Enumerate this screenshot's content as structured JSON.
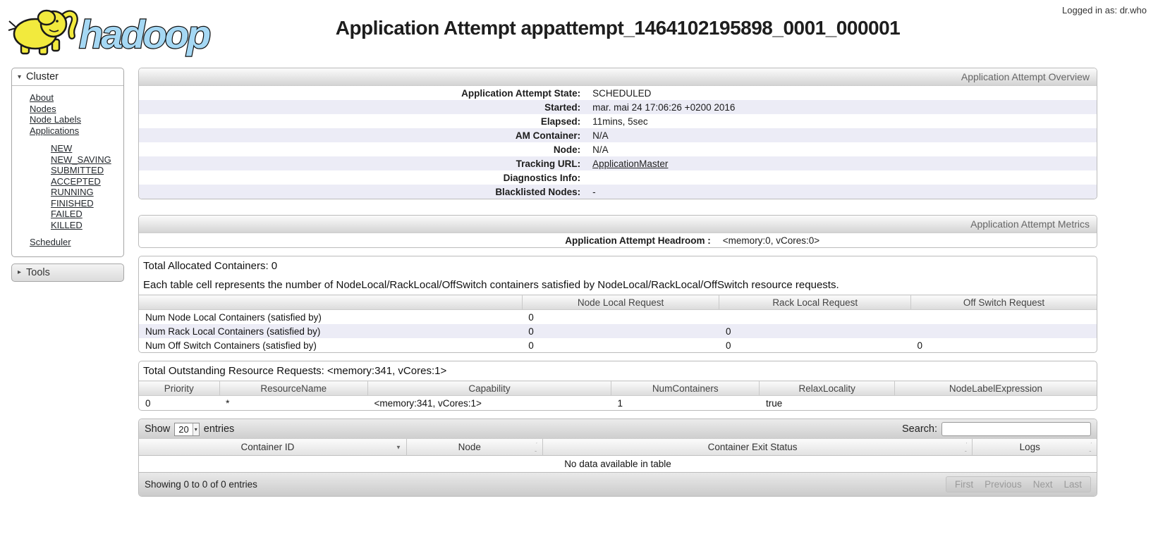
{
  "header": {
    "logo_text": "hadoop",
    "title": "Application Attempt appattempt_1464102195898_0001_000001",
    "logged_in_as": "Logged in as: dr.who"
  },
  "colors": {
    "row_stripe": "#ececf6",
    "logo_blue": "#a5d8f4",
    "logo_yellow": "#f2ea3d"
  },
  "sidebar": {
    "cluster": {
      "label": "Cluster",
      "items": [
        "About",
        "Nodes",
        "Node Labels",
        "Applications"
      ],
      "subitems": [
        "NEW",
        "NEW_SAVING",
        "SUBMITTED",
        "ACCEPTED",
        "RUNNING",
        "FINISHED",
        "FAILED",
        "KILLED"
      ],
      "footer_item": "Scheduler"
    },
    "tools_label": "Tools"
  },
  "overview": {
    "bar": "Application Attempt Overview",
    "rows": [
      {
        "label": "Application Attempt State:",
        "value": "SCHEDULED"
      },
      {
        "label": "Started:",
        "value": "mar. mai 24 17:06:26 +0200 2016"
      },
      {
        "label": "Elapsed:",
        "value": "11mins, 5sec"
      },
      {
        "label": "AM Container:",
        "value": "N/A"
      },
      {
        "label": "Node:",
        "value": "N/A"
      },
      {
        "label": "Tracking URL:",
        "value": "ApplicationMaster"
      },
      {
        "label": "Diagnostics Info:",
        "value": ""
      },
      {
        "label": "Blacklisted Nodes:",
        "value": "-"
      }
    ]
  },
  "metrics": {
    "bar": "Application Attempt Metrics",
    "rows": [
      {
        "label": "Application Attempt Headroom :",
        "value": "<memory:0, vCores:0>"
      }
    ]
  },
  "allocated": {
    "title": "Total Allocated Containers: 0",
    "description": "Each table cell represents the number of NodeLocal/RackLocal/OffSwitch containers satisfied by NodeLocal/RackLocal/OffSwitch resource requests.",
    "table": {
      "headers": [
        "",
        "Node Local Request",
        "Rack Local Request",
        "Off Switch Request"
      ],
      "rows": [
        [
          "Num Node Local Containers (satisfied by)",
          "0",
          "",
          ""
        ],
        [
          "Num Rack Local Containers (satisfied by)",
          "0",
          "0",
          ""
        ],
        [
          "Num Off Switch Containers (satisfied by)",
          "0",
          "0",
          "0"
        ]
      ]
    }
  },
  "outstanding": {
    "title": "Total Outstanding Resource Requests: <memory:341, vCores:1>",
    "table": {
      "headers": [
        "Priority",
        "ResourceName",
        "Capability",
        "NumContainers",
        "RelaxLocality",
        "NodeLabelExpression"
      ],
      "rows": [
        [
          "0",
          "*",
          "<memory:341, vCores:1>",
          "1",
          "true",
          ""
        ]
      ]
    }
  },
  "containers_table": {
    "show_label": "Show",
    "show_value": "20",
    "entries_label": "entries",
    "search_label": "Search:",
    "search_value": "",
    "headers": [
      "Container ID",
      "Node",
      "Container Exit Status",
      "Logs"
    ],
    "empty_message": "No data available in table",
    "info": "Showing 0 to 0 of 0 entries",
    "pagination": [
      "First",
      "Previous",
      "Next",
      "Last"
    ]
  }
}
